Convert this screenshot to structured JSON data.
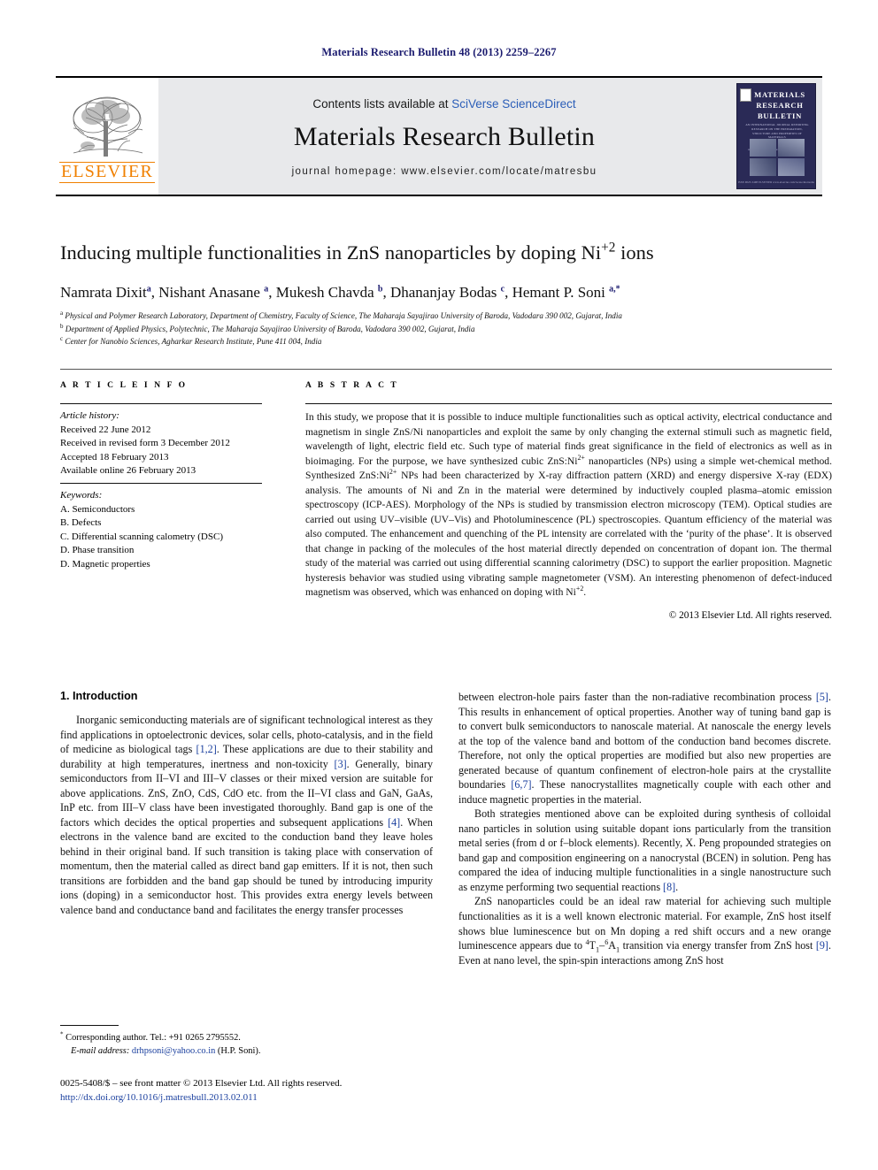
{
  "running_head": "Materials Research Bulletin 48 (2013) 2259–2267",
  "masthead": {
    "publisher_name": "ELSEVIER",
    "contents_prefix": "Contents lists available at ",
    "contents_link": "SciVerse ScienceDirect",
    "journal_name": "Materials Research Bulletin",
    "homepage": "journal homepage: www.elsevier.com/locate/matresbu",
    "cover": {
      "title_line1": "MATERIALS",
      "title_line2": "RESEARCH",
      "title_line3": "BULLETIN",
      "sub_line": "AN INTERNATIONAL JOURNAL REPORTING RESEARCH ON THE PREPARATION, STRUCTURE AND PROPERTIES OF MATERIALS",
      "mid_line": "Available online at www.sciencedirect.com",
      "foot_line": "ISSN 0025-5408  ELSEVIER  www.elsevier.com/locate/matresbu"
    }
  },
  "article": {
    "title_main": "Inducing multiple functionalities in ZnS nanoparticles by doping Ni",
    "title_sup": "+2",
    "title_tail": " ions",
    "authors": [
      {
        "name": "Namrata Dixit",
        "mark": "a"
      },
      {
        "name": "Nishant Anasane",
        "mark": "a"
      },
      {
        "name": "Mukesh Chavda",
        "mark": "b"
      },
      {
        "name": "Dhananjay Bodas",
        "mark": "c"
      },
      {
        "name": "Hemant P. Soni",
        "mark": "a,*"
      }
    ],
    "affiliations": [
      {
        "mark": "a",
        "text": "Physical and Polymer Research Laboratory, Department of Chemistry, Faculty of Science, The Maharaja Sayajirao University of Baroda, Vadodara 390 002, Gujarat, India"
      },
      {
        "mark": "b",
        "text": "Department of Applied Physics, Polytechnic, The Maharaja Sayajirao University of Baroda, Vadodara 390 002, Gujarat, India"
      },
      {
        "mark": "c",
        "text": "Center for Nanobio Sciences, Agharkar Research Institute, Pune 411 004, India"
      }
    ]
  },
  "info": {
    "heading": "A R T I C L E  I N F O",
    "history_label": "Article history:",
    "history": [
      "Received 22 June 2012",
      "Received in revised form 3 December 2012",
      "Accepted 18 February 2013",
      "Available online 26 February 2013"
    ],
    "keywords_label": "Keywords:",
    "keywords": [
      "A. Semiconductors",
      "B. Defects",
      "C. Differential scanning calometry (DSC)",
      "D. Phase transition",
      "D. Magnetic properties"
    ]
  },
  "abstract": {
    "heading": "A B S T R A C T",
    "paragraph_1": "In this study, we propose that it is possible to induce multiple functionalities such as optical activity, electrical conductance and magnetism in single ZnS/Ni nanoparticles and exploit the same by only changing the external stimuli such as magnetic field, wavelength of light, electric field etc. Such type of material finds great significance in the field of electronics as well as in bioimaging. For the purpose, we have synthesized cubic ZnS:Ni",
    "sup_1": "2+",
    "paragraph_2": " nanoparticles (NPs) using a simple wet-chemical method. Synthesized ZnS:Ni",
    "sup_2": "2+",
    "paragraph_3": " NPs had been characterized by X-ray diffraction pattern (XRD) and energy dispersive X-ray (EDX) analysis. The amounts of Ni and Zn in the material were determined by inductively coupled plasma–atomic emission spectroscopy (ICP-AES). Morphology of the NPs is studied by transmission electron microscopy (TEM). Optical studies are carried out using UV–visible (UV–Vis) and Photoluminescence (PL) spectroscopies. Quantum efficiency of the material was also computed. The enhancement and quenching of the PL intensity are correlated with the ‘purity of the phase’. It is observed that change in packing of the molecules of the host material directly depended on concentration of dopant ion. The thermal study of the material was carried out using differential scanning calorimetry (DSC) to support the earlier proposition. Magnetic hysteresis behavior was studied using vibrating sample magnetometer (VSM). An interesting phenomenon of defect-induced magnetism was observed, which was enhanced on doping with Ni",
    "sup_3": "+2",
    "paragraph_4": ".",
    "copyright": "© 2013 Elsevier Ltd. All rights reserved."
  },
  "body": {
    "section_number_title": "1. Introduction",
    "left_column": {
      "p1_a": "Inorganic semiconducting materials are of significant technological interest as they find applications in optoelectronic devices, solar cells, photo-catalysis, and in the field of medicine as biological tags ",
      "ref1": "[1,2]",
      "p1_b": ". These applications are due to their stability and durability at high temperatures, inertness and non-toxicity ",
      "ref2": "[3]",
      "p1_c": ". Generally, binary semiconductors from II–VI and III–V classes or their mixed version are suitable for above applications. ZnS, ZnO, CdS, CdO etc. from the II–VI class and GaN, GaAs, InP etc. from III–V class have been investigated thoroughly. Band gap is one of the factors which decides the optical properties and subsequent applications ",
      "ref3": "[4]",
      "p1_d": ". When electrons in the valence band are excited to the conduction band they leave holes behind in their original band. If such transition is taking place with conservation of momentum, then the material called as direct band gap emitters. If it is not, then such transitions are forbidden and the band gap should be tuned by introducing impurity ions (doping) in a semiconductor host. This provides extra energy levels between valence band and conductance band and facilitates the energy transfer processes"
    },
    "right_column": {
      "p1_a": "between electron-hole pairs faster than the non-radiative recombination process ",
      "ref5": "[5]",
      "p1_b": ". This results in enhancement of optical properties. Another way of tuning band gap is to convert bulk semiconductors to nanoscale material. At nanoscale the energy levels at the top of the valence band and bottom of the conduction band becomes discrete. Therefore, not only the optical properties are modified but also new properties are generated because of quantum confinement of electron-hole pairs at the crystallite boundaries ",
      "ref67": "[6,7]",
      "p1_c": ". These nanocrystallites magnetically couple with each other and induce magnetic properties in the material.",
      "p2_a": "Both strategies mentioned above can be exploited during synthesis of colloidal nano particles in solution using suitable dopant ions particularly from the transition metal series (from d or f–block elements). Recently, X. Peng propounded strategies on band gap and composition engineering on a nanocrystal (BCEN) in solution. Peng has compared the idea of inducing multiple functionalities in a single nanostructure such as enzyme performing two sequential reactions ",
      "ref8": "[8]",
      "p2_b": ".",
      "p3_a": "ZnS nanoparticles could be an ideal raw material for achieving such multiple functionalities as it is a well known electronic material. For example, ZnS host itself shows blue luminescence but on Mn doping a red shift occurs and a new orange luminescence appears due to ",
      "trans_sup1": "4",
      "trans_t": "T",
      "trans_sub1": "1",
      "trans_dash": "–",
      "trans_sup2": "6",
      "trans_a": "A",
      "trans_sub2": "1",
      "p3_b": " transition via energy transfer from ZnS host ",
      "ref9": "[9]",
      "p3_c": ". Even at nano level, the spin-spin interactions among ZnS host"
    }
  },
  "footnotes": {
    "corresponding": "Corresponding author. Tel.: +91 0265 2795552.",
    "email_label": "E-mail address:",
    "email": "drhpsoni@yahoo.co.in",
    "email_owner": "(H.P. Soni).",
    "issn_line": "0025-5408/$ – see front matter © 2013 Elsevier Ltd. All rights reserved.",
    "doi": "http://dx.doi.org/10.1016/j.matresbull.2013.02.011"
  }
}
